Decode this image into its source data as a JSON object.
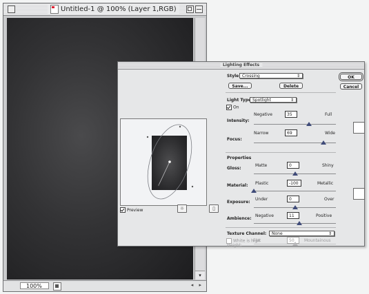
{
  "document": {
    "title": "Untitled-1 @ 100% (Layer 1,RGB)",
    "zoom_value": "100%"
  },
  "dialog": {
    "title": "Lighting Effects",
    "style_label": "Style:",
    "style_value": "Crossing",
    "save_label": "Save...",
    "delete_label": "Delete",
    "ok_label": "OK",
    "cancel_label": "Cancel",
    "light_type_label": "Light Type:",
    "light_type_value": "Spotlight",
    "on_label": "On",
    "intensity": {
      "label": "Intensity:",
      "low": "Negative",
      "high": "Full",
      "value": "35",
      "level": 35,
      "min": -100,
      "max": 100
    },
    "focus": {
      "label": "Focus:",
      "low": "Narrow",
      "high": "Wide",
      "value": "69",
      "level": 69,
      "min": -100,
      "max": 100
    },
    "properties_label": "Properties",
    "gloss": {
      "label": "Gloss:",
      "low": "Matte",
      "high": "Shiny",
      "value": "0",
      "level": 0,
      "min": -100,
      "max": 100
    },
    "material": {
      "label": "Material:",
      "low": "Plastic",
      "high": "Metallic",
      "value": "-100",
      "level": -100,
      "min": -100,
      "max": 100
    },
    "exposure": {
      "label": "Exposure:",
      "low": "Under",
      "high": "Over",
      "value": "0",
      "level": 0,
      "min": -100,
      "max": 100
    },
    "ambience": {
      "label": "Ambience:",
      "low": "Negative",
      "high": "Positive",
      "value": "11",
      "level": 11,
      "min": -100,
      "max": 100
    },
    "texture_channel_label": "Texture Channel:",
    "texture_channel_value": "None",
    "white_is_high_label": "White is high",
    "height": {
      "label": "Height:",
      "low": "Flat",
      "high": "Mountainous",
      "value": "50",
      "level": 50,
      "min": 0,
      "max": 100
    },
    "preview_label": "Preview",
    "preview_checked": true,
    "on_checked": true,
    "light_color": "#ffffff",
    "ambient_color": "#ffffff"
  }
}
